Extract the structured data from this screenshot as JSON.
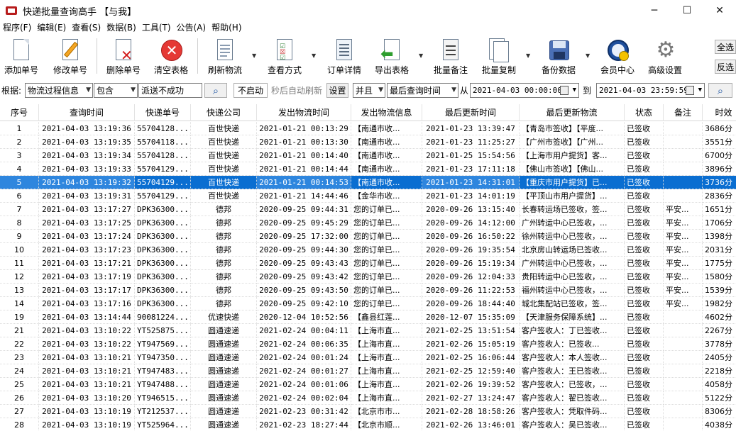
{
  "window": {
    "title": "快递批量查询高手 【与我】",
    "min_glyph": "─",
    "max_glyph": "☐",
    "close_glyph": "✕"
  },
  "menu": [
    "程序(F)",
    "编辑(E)",
    "查看(S)",
    "数据(B)",
    "工具(T)",
    "公告(A)",
    "帮助(H)"
  ],
  "toolbar": {
    "add": "添加单号",
    "edit": "修改单号",
    "delete": "删除单号",
    "clear": "清空表格",
    "refresh": "刷新物流",
    "view_mode": "查看方式",
    "order_detail": "订单详情",
    "export": "导出表格",
    "batch_note": "批量备注",
    "batch_copy": "批量复制",
    "backup": "备份数据",
    "member": "会员中心",
    "advanced": "高级设置",
    "select_all": "全选",
    "invert": "反选"
  },
  "filter": {
    "by_label": "根据:",
    "field": "物流过程信息",
    "op": "包含",
    "value": "派送不成功",
    "search_glyph": "⌕",
    "autorefresh_state": "不启动",
    "autorefresh_label": "秒后自动刷新",
    "settings": "设置",
    "logic": "并且",
    "time_field": "最后查询时间",
    "from_label": "从",
    "from": "2021-04-03 00:00:00",
    "to_label": "到",
    "to": "2021-04-03 23:59:59"
  },
  "table": {
    "columns": [
      "序号",
      "查询时间",
      "快递单号",
      "快递公司",
      "发出物流时间",
      "发出物流信息",
      "最后更新时间",
      "最后更新物流",
      "状态",
      "备注",
      "时效"
    ],
    "selected_index": 4,
    "rows": [
      [
        "1",
        "2021-04-03 13:19:36",
        "55704128...",
        "百世快递",
        "2021-01-21 00:13:29",
        "【南通市收...",
        "2021-01-23 13:39:47",
        "【青岛市签收】【平度...",
        "已签收",
        "",
        "3686分"
      ],
      [
        "2",
        "2021-04-03 13:19:35",
        "55704118...",
        "百世快递",
        "2021-01-21 00:13:30",
        "【南通市收...",
        "2021-01-23 11:25:27",
        "【广州市签收】【广州...",
        "已签收",
        "",
        "3551分"
      ],
      [
        "3",
        "2021-04-03 13:19:34",
        "55704128...",
        "百世快递",
        "2021-01-21 00:14:40",
        "【南通市收...",
        "2021-01-25 15:54:56",
        "【上海市用户提货】客...",
        "已签收",
        "",
        "6700分"
      ],
      [
        "4",
        "2021-04-03 13:19:33",
        "55704129...",
        "百世快递",
        "2021-01-21 00:14:44",
        "【南通市收...",
        "2021-01-23 17:11:18",
        "【佛山市签收】【佛山...",
        "已签收",
        "",
        "3896分"
      ],
      [
        "5",
        "2021-04-03 13:19:32",
        "55704129...",
        "百世快递",
        "2021-01-21 00:14:53",
        "【南通市收...",
        "2021-01-23 14:31:01",
        "【重庆市用户提货】已...",
        "已签收",
        "",
        "3736分"
      ],
      [
        "6",
        "2021-04-03 13:19:31",
        "55704129...",
        "百世快递",
        "2021-01-21 14:44:46",
        "【金华市收...",
        "2021-01-23 14:01:19",
        "【平顶山市用户提货】...",
        "已签收",
        "",
        "2836分"
      ],
      [
        "7",
        "2021-04-03 13:17:27",
        "DPK36300...",
        "德邦",
        "2020-09-25 09:44:31",
        "您的订单已...",
        "2020-09-26 13:15:40",
        "长春转运场已签收，签...",
        "已签收",
        "平安...",
        "1651分"
      ],
      [
        "8",
        "2021-04-03 13:17:25",
        "DPK36300...",
        "德邦",
        "2020-09-25 09:45:29",
        "您的订单已...",
        "2020-09-26 14:12:00",
        "广州转运中心已签收，...",
        "已签收",
        "平安...",
        "1706分"
      ],
      [
        "9",
        "2021-04-03 13:17:24",
        "DPK36300...",
        "德邦",
        "2020-09-25 17:32:00",
        "您的订单已...",
        "2020-09-26 16:50:22",
        "徐州转运中心已签收，...",
        "已签收",
        "平安...",
        "1398分"
      ],
      [
        "10",
        "2021-04-03 13:17:23",
        "DPK36300...",
        "德邦",
        "2020-09-25 09:44:30",
        "您的订单已...",
        "2020-09-26 19:35:54",
        "北京房山转运场已签收...",
        "已签收",
        "平安...",
        "2031分"
      ],
      [
        "11",
        "2021-04-03 13:17:21",
        "DPK36300...",
        "德邦",
        "2020-09-25 09:43:43",
        "您的订单已...",
        "2020-09-26 15:19:34",
        "广州转运中心已签收，...",
        "已签收",
        "平安...",
        "1775分"
      ],
      [
        "12",
        "2021-04-03 13:17:19",
        "DPK36300...",
        "德邦",
        "2020-09-25 09:43:42",
        "您的订单已...",
        "2020-09-26 12:04:33",
        "贵阳转运中心已签收，...",
        "已签收",
        "平安...",
        "1580分"
      ],
      [
        "13",
        "2021-04-03 13:17:17",
        "DPK36300...",
        "德邦",
        "2020-09-25 09:43:50",
        "您的订单已...",
        "2020-09-26 11:22:53",
        "福州转运中心已签收，...",
        "已签收",
        "平安...",
        "1539分"
      ],
      [
        "14",
        "2021-04-03 13:17:16",
        "DPK36300...",
        "德邦",
        "2020-09-25 09:42:10",
        "您的订单已...",
        "2020-09-26 18:44:40",
        "城北集配站已签收，签...",
        "已签收",
        "平安...",
        "1982分"
      ],
      [
        "19",
        "2021-04-03 13:14:44",
        "90081224...",
        "优速快递",
        "2020-12-04 10:52:56",
        "【鑫县红莲...",
        "2020-12-07 15:35:09",
        "【天津服务保障系统】...",
        "已签收",
        "",
        "4602分"
      ],
      [
        "21",
        "2021-04-03 13:10:22",
        "YT525875...",
        "圆通速递",
        "2021-02-24 00:04:11",
        "【上海市直...",
        "2021-02-25 13:51:54",
        "客户签收人：丁已签收...",
        "已签收",
        "",
        "2267分"
      ],
      [
        "22",
        "2021-04-03 13:10:22",
        "YT947569...",
        "圆通速递",
        "2021-02-24 00:06:35",
        "【上海市直...",
        "2021-02-26 15:05:19",
        "客户签收人：已签收...",
        "已签收",
        "",
        "3778分"
      ],
      [
        "23",
        "2021-04-03 13:10:21",
        "YT947350...",
        "圆通速递",
        "2021-02-24 00:01:24",
        "【上海市直...",
        "2021-02-25 16:06:44",
        "客户签收人：本人签收...",
        "已签收",
        "",
        "2405分"
      ],
      [
        "24",
        "2021-04-03 13:10:21",
        "YT947483...",
        "圆通速递",
        "2021-02-24 00:01:27",
        "【上海市直...",
        "2021-02-25 12:59:40",
        "客户签收人：王已签收...",
        "已签收",
        "",
        "2218分"
      ],
      [
        "25",
        "2021-04-03 13:10:21",
        "YT947488...",
        "圆通速递",
        "2021-02-24 00:01:06",
        "【上海市直...",
        "2021-02-26 19:39:52",
        "客户签收人：已签收，...",
        "已签收",
        "",
        "4058分"
      ],
      [
        "26",
        "2021-04-03 13:10:20",
        "YT946515...",
        "圆通速递",
        "2021-02-24 00:02:04",
        "【上海市直...",
        "2021-02-27 13:24:47",
        "客户签收人：翟已签收...",
        "已签收",
        "",
        "5122分"
      ],
      [
        "27",
        "2021-04-03 13:10:19",
        "YT212537...",
        "圆通速递",
        "2021-02-23 00:31:42",
        "【北京市市...",
        "2021-02-28 18:58:26",
        "客户签收人：凭取件码...",
        "已签收",
        "",
        "8306分"
      ],
      [
        "28",
        "2021-04-03 13:10:19",
        "YT525964...",
        "圆通速递",
        "2021-02-23 18:27:44",
        "【北京市顺...",
        "2021-02-26 13:46:01",
        "客户签收人：吴已签收...",
        "已签收",
        "",
        "4038分"
      ]
    ]
  }
}
